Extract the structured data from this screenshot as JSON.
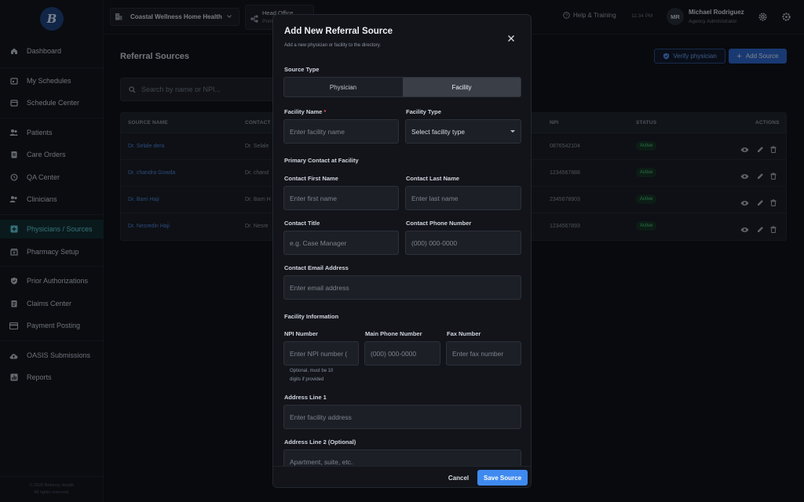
{
  "app": {
    "logo_text": "B"
  },
  "sidebar": {
    "items": [
      {
        "label": "Dashboard",
        "icon": "home-icon"
      },
      {
        "label": "My Schedules",
        "icon": "calendar-icon"
      },
      {
        "label": "Schedule Center",
        "icon": "calendar-icon"
      },
      {
        "label": "Patients",
        "icon": "people-icon"
      },
      {
        "label": "Care Orders",
        "icon": "clipboard-icon"
      },
      {
        "label": "QA Center",
        "icon": "history-icon"
      },
      {
        "label": "Clinicians",
        "icon": "people-icon"
      },
      {
        "label": "Physicians / Sources",
        "icon": "medical-plus-icon",
        "active": true
      },
      {
        "label": "Pharmacy Setup",
        "icon": "pharmacy-icon"
      },
      {
        "label": "Prior Authorizations",
        "icon": "shield-check-icon"
      },
      {
        "label": "Claims Center",
        "icon": "document-icon"
      },
      {
        "label": "Payment Posting",
        "icon": "credit-card-icon"
      },
      {
        "label": "OASIS Submissions",
        "icon": "cloud-upload-icon"
      },
      {
        "label": "Reports",
        "icon": "bar-chart-icon"
      }
    ],
    "copyright_line1": "© 2025 Betterzy Health",
    "copyright_line2": "All rights reserved."
  },
  "topbar": {
    "agency": "Coastal Wellness Home Health",
    "office_title": "Head Office",
    "office_sub": "Prim",
    "help": "Help & Training",
    "time": "11:34 PM",
    "avatar_initials": "MR",
    "user_name": "Michael Rodriguez",
    "user_role": "Agency Administrator"
  },
  "page": {
    "title": "Referral Sources",
    "verify_button": "Verify physician",
    "add_button": "Add Source",
    "search_placeholder": "Search by name or NPI..."
  },
  "table": {
    "headers": {
      "name": "SOURCE NAME",
      "contact": "CONTACT",
      "npi": "NPI",
      "status": "STATUS",
      "actions": "ACTIONS"
    },
    "rows": [
      {
        "name": "Dr. Selale dera",
        "contact": "Dr. Selale",
        "npi": "0876542104",
        "status": "Active"
      },
      {
        "name": "Dr. chandra Gowda",
        "contact": "Dr. chand",
        "npi": "1234567888",
        "status": "Active"
      },
      {
        "name": "Dr. Barri Haji",
        "contact": "Dr. Barri H",
        "npi": "2345678903",
        "status": "Active"
      },
      {
        "name": "Dr. Nesredin Haji",
        "contact": "Dr. Nesre",
        "npi": "1234567893",
        "status": "Active"
      }
    ]
  },
  "modal": {
    "title": "Add New Referral Source",
    "subtitle": "Add a new physician or facility to the directory.",
    "source_type_label": "Source Type",
    "source_types": [
      "Physician",
      "Facility"
    ],
    "selected_source_type": "Facility",
    "facility_name_label": "Facility Name",
    "required_mark": "*",
    "facility_name_placeholder": "Enter facility name",
    "facility_type_label": "Facility Type",
    "facility_type_value": "Select facility type",
    "primary_contact_section": "Primary Contact at Facility",
    "contact_first_label": "Contact First Name",
    "contact_first_placeholder": "Enter first name",
    "contact_last_label": "Contact Last Name",
    "contact_last_placeholder": "Enter last name",
    "contact_title_label": "Contact Title",
    "contact_title_placeholder": "e.g. Case Manager",
    "contact_phone_label": "Contact Phone Number",
    "contact_phone_placeholder": "(000) 000-0000",
    "contact_email_label": "Contact Email Address",
    "contact_email_placeholder": "Enter email address",
    "facility_info_section": "Facility Information",
    "npi_label": "NPI Number",
    "npi_placeholder": "Enter NPI number (",
    "npi_hint_line1": "Optional, must be 10",
    "npi_hint_line2": "digits if provided",
    "main_phone_label": "Main Phone Number",
    "main_phone_placeholder": "(000) 000-0000",
    "fax_label": "Fax Number",
    "fax_placeholder": "Enter fax number",
    "address1_label": "Address Line 1",
    "address1_placeholder": "Enter facility address",
    "address2_label": "Address Line 2 (Optional)",
    "address2_placeholder": "Apartment, suite, etc.",
    "cancel_button": "Cancel",
    "save_button": "Save Source"
  },
  "colors": {
    "accent": "#3f8af0",
    "active_nav": "#5fc9d5",
    "link": "#4d82d6",
    "status_active": "#4cc77c",
    "required": "#e0574f"
  }
}
